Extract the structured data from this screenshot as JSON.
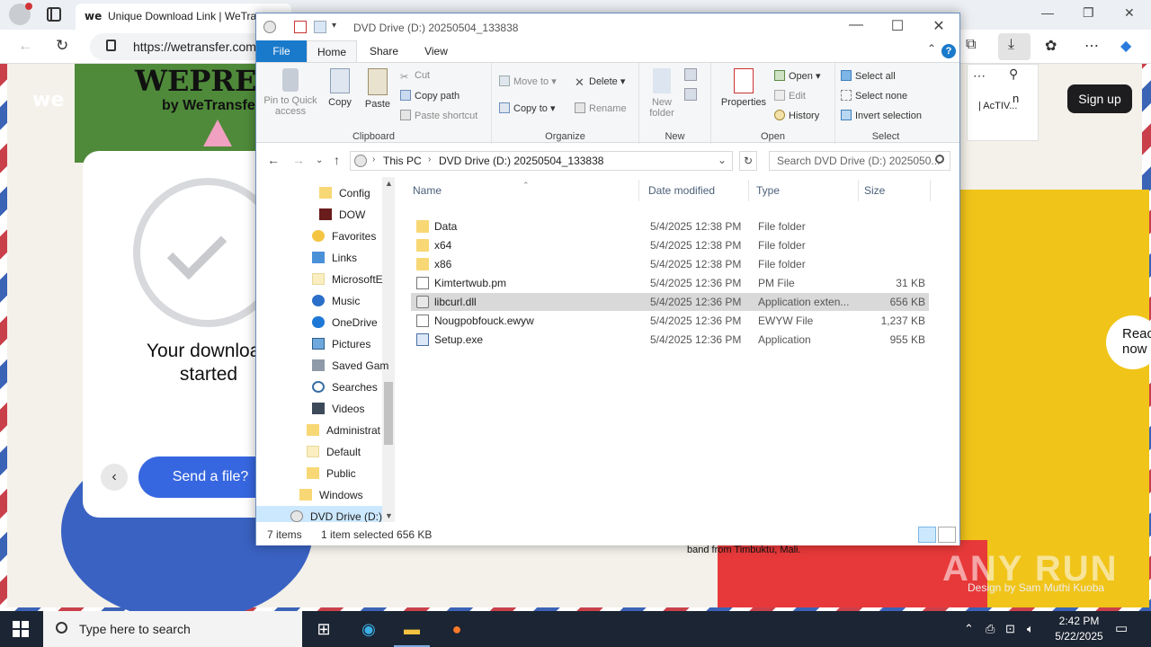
{
  "browser": {
    "tab_favicon": "we",
    "tab_title": "Unique Download Link | WeTra",
    "url": "https://wetransfer.com",
    "window_controls": {
      "minimize": "—",
      "restore": "❐",
      "close": "✕"
    }
  },
  "page": {
    "wepresent": "WEPRESEN",
    "by_wetransfer": "by WeTransfer",
    "we_logo": "we",
    "download_title_line1": "Your download",
    "download_title_line2": "started",
    "send_button": "Send a file?",
    "prev_arrow": "‹",
    "signup_button": "Sign up",
    "side_panel_text_1": "n",
    "side_panel_text_2": "| AcTIV...",
    "read_now_line1": "Reac",
    "read_now_line2": "now",
    "caption": "band from Timbuktu, Mali.",
    "design_credit": "Design by Sam Muthi Kuoba",
    "watermark": "ANY RUN"
  },
  "explorer": {
    "title": "DVD Drive (D:) 20250504_133838",
    "tabs": {
      "file": "File",
      "home": "Home",
      "share": "Share",
      "view": "View"
    },
    "help": "?",
    "ribbon": {
      "clipboard": {
        "label": "Clipboard",
        "pin": "Pin to Quick access",
        "copy": "Copy",
        "paste": "Paste",
        "cut": "Cut",
        "copy_path": "Copy path",
        "paste_shortcut": "Paste shortcut"
      },
      "organize": {
        "label": "Organize",
        "move_to": "Move to",
        "copy_to": "Copy to",
        "delete": "Delete",
        "rename": "Rename"
      },
      "new": {
        "label": "New",
        "new_folder": "New folder"
      },
      "open": {
        "label": "Open",
        "properties": "Properties",
        "open": "Open",
        "edit": "Edit",
        "history": "History"
      },
      "select": {
        "label": "Select",
        "select_all": "Select all",
        "select_none": "Select none",
        "invert": "Invert selection"
      }
    },
    "path": {
      "this_pc": "This PC",
      "drive": "DVD Drive (D:) 20250504_133838"
    },
    "search_placeholder": "Search DVD Drive (D:) 2025050...",
    "tree": [
      {
        "label": "Config",
        "icon": "folder"
      },
      {
        "label": "DOW",
        "icon": "app"
      },
      {
        "label": "Favorites",
        "icon": "star"
      },
      {
        "label": "Links",
        "icon": "link"
      },
      {
        "label": "MicrosoftE",
        "icon": "folder-pale"
      },
      {
        "label": "Music",
        "icon": "music"
      },
      {
        "label": "OneDrive",
        "icon": "cloud"
      },
      {
        "label": "Pictures",
        "icon": "pictures"
      },
      {
        "label": "Saved Gam",
        "icon": "game"
      },
      {
        "label": "Searches",
        "icon": "search"
      },
      {
        "label": "Videos",
        "icon": "videos"
      },
      {
        "label": "Administrat",
        "icon": "folder"
      },
      {
        "label": "Default",
        "icon": "folder-pale"
      },
      {
        "label": "Public",
        "icon": "folder"
      },
      {
        "label": "Windows",
        "icon": "folder"
      },
      {
        "label": "DVD Drive (D:)",
        "icon": "drive"
      }
    ],
    "columns": {
      "name": "Name",
      "date": "Date modified",
      "type": "Type",
      "size": "Size"
    },
    "files": [
      {
        "name": "Data",
        "date": "5/4/2025 12:38 PM",
        "type": "File folder",
        "size": "",
        "icon": "folder"
      },
      {
        "name": "x64",
        "date": "5/4/2025 12:38 PM",
        "type": "File folder",
        "size": "",
        "icon": "folder"
      },
      {
        "name": "x86",
        "date": "5/4/2025 12:38 PM",
        "type": "File folder",
        "size": "",
        "icon": "folder"
      },
      {
        "name": "Kimtertwub.pm",
        "date": "5/4/2025 12:36 PM",
        "type": "PM File",
        "size": "31 KB",
        "icon": "file"
      },
      {
        "name": "libcurl.dll",
        "date": "5/4/2025 12:36 PM",
        "type": "Application exten...",
        "size": "656 KB",
        "icon": "dll"
      },
      {
        "name": "Nougpobfouck.ewyw",
        "date": "5/4/2025 12:36 PM",
        "type": "EWYW File",
        "size": "1,237 KB",
        "icon": "file"
      },
      {
        "name": "Setup.exe",
        "date": "5/4/2025 12:36 PM",
        "type": "Application",
        "size": "955 KB",
        "icon": "exe"
      }
    ],
    "status": {
      "count": "7 items",
      "selected": "1 item selected  656 KB"
    }
  },
  "taskbar": {
    "search_placeholder": "Type here to search",
    "time": "2:42 PM",
    "date": "5/22/2025"
  }
}
